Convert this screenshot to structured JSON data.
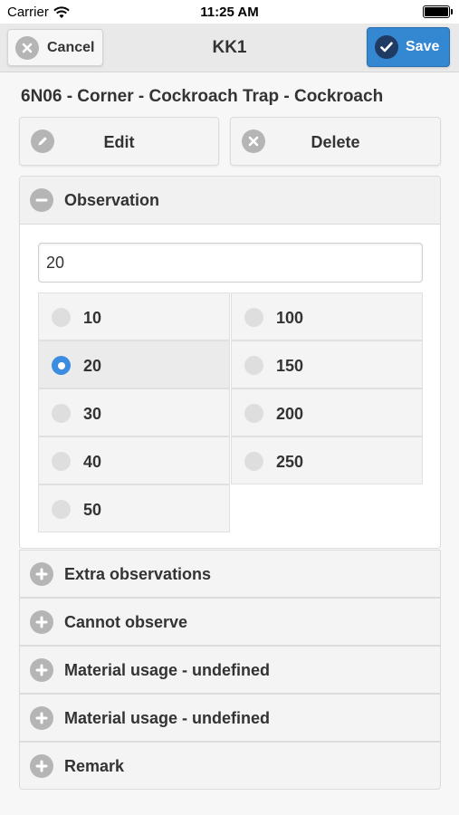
{
  "status_bar": {
    "carrier": "Carrier",
    "time": "11:25 AM"
  },
  "header": {
    "title": "KK1",
    "cancel_label": "Cancel",
    "save_label": "Save",
    "cancel_icon": "close-circle-icon",
    "save_icon": "check-circle-icon"
  },
  "page_title": "6N06 - Corner - Cockroach Trap - Cockroach",
  "actions": {
    "edit_label": "Edit",
    "delete_label": "Delete"
  },
  "observation": {
    "heading": "Observation",
    "input_value": "20",
    "options": [
      "10",
      "20",
      "30",
      "40",
      "50",
      "100",
      "150",
      "200",
      "250"
    ],
    "selected": "20"
  },
  "sections": [
    {
      "label": "Extra observations"
    },
    {
      "label": "Cannot observe"
    },
    {
      "label": "Material usage - undefined"
    },
    {
      "label": "Material usage - undefined"
    },
    {
      "label": "Remark"
    }
  ],
  "colors": {
    "accent": "#3487d1",
    "radio_selected": "#3c8ce0",
    "icon_gray": "#b5b5b5"
  }
}
